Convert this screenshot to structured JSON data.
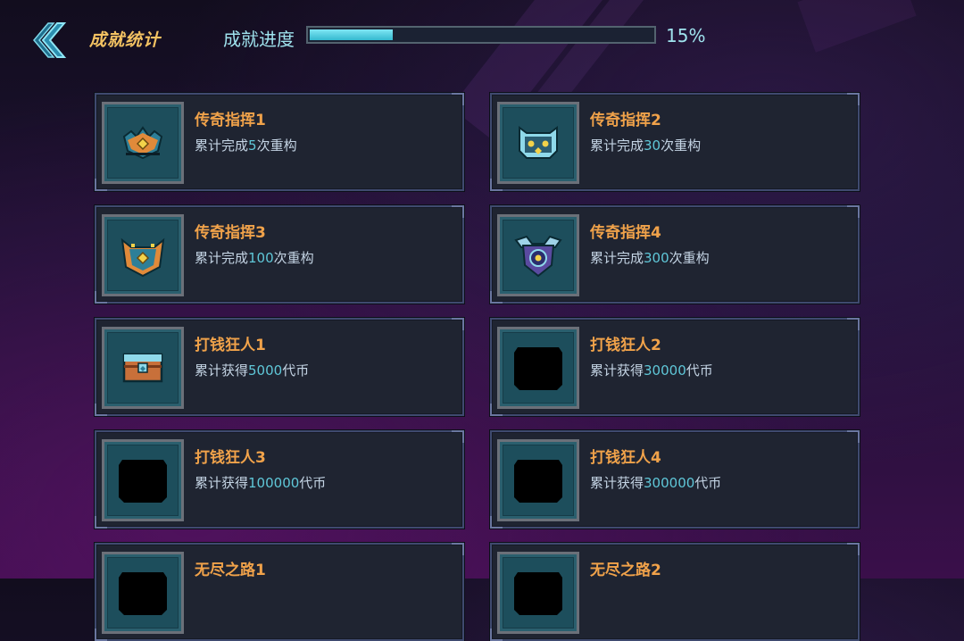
{
  "header": {
    "title": "成就统计",
    "progress_label": "成就进度",
    "progress_value_text": "15%",
    "progress_fraction": 0.15
  },
  "achievements": [
    {
      "name": "传奇指挥1",
      "desc_prefix": "累计完成",
      "desc_number": "5",
      "desc_suffix": "次重构",
      "icon": "crown-emblem-icon"
    },
    {
      "name": "传奇指挥2",
      "desc_prefix": "累计完成",
      "desc_number": "30",
      "desc_suffix": "次重构",
      "icon": "cat-mask-emblem-icon"
    },
    {
      "name": "传奇指挥3",
      "desc_prefix": "累计完成",
      "desc_number": "100",
      "desc_suffix": "次重构",
      "icon": "horned-shield-icon"
    },
    {
      "name": "传奇指挥4",
      "desc_prefix": "累计完成",
      "desc_number": "300",
      "desc_suffix": "次重构",
      "icon": "winged-shield-icon"
    },
    {
      "name": "打钱狂人1",
      "desc_prefix": "累计获得",
      "desc_number": "5000",
      "desc_suffix": "代币",
      "icon": "treasure-chest-icon"
    },
    {
      "name": "打钱狂人2",
      "desc_prefix": "累计获得",
      "desc_number": "30000",
      "desc_suffix": "代币",
      "icon": "locked-icon"
    },
    {
      "name": "打钱狂人3",
      "desc_prefix": "累计获得",
      "desc_number": "100000",
      "desc_suffix": "代币",
      "icon": "locked-icon"
    },
    {
      "name": "打钱狂人4",
      "desc_prefix": "累计获得",
      "desc_number": "300000",
      "desc_suffix": "代币",
      "icon": "locked-icon"
    },
    {
      "name": "无尽之路1",
      "desc_prefix": "",
      "desc_number": "",
      "desc_suffix": "",
      "icon": "locked-icon"
    },
    {
      "name": "无尽之路2",
      "desc_prefix": "",
      "desc_number": "",
      "desc_suffix": "",
      "icon": "locked-icon"
    }
  ],
  "colors": {
    "accent": "#f0a24a",
    "progress_fill": "#4cc8dc",
    "highlight_number": "#5fc7d8"
  }
}
